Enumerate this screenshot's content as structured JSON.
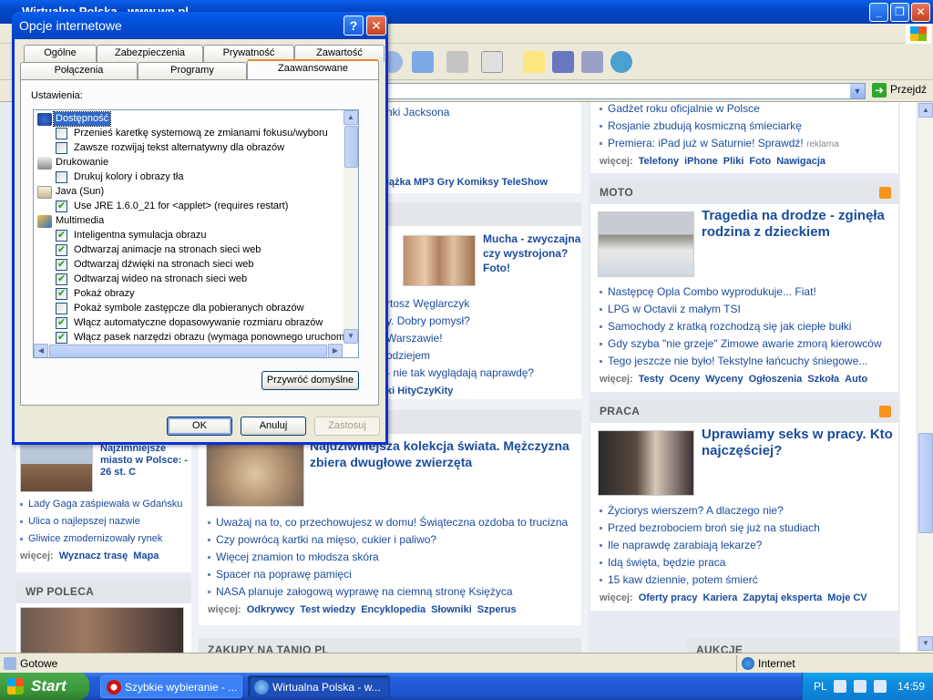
{
  "browser": {
    "title": "Wirtualna Polska - www.wp.pl",
    "go_label": "Przejdź",
    "status": "Gotowe",
    "zone": "Internet"
  },
  "page": {
    "left": {
      "weather_headline": "Najzimniejsze miasto w Polsce: - 26 st. C",
      "links": [
        "Lady Gaga zaśpiewała w Gdańsku",
        "Ulica o najlepszej nazwie",
        "Gliwice zmodernizowały rynek"
      ],
      "more_label": "więcej:",
      "more": [
        "Wyznacz trasę",
        "Mapa"
      ],
      "poleca_head": "WP POLECA"
    },
    "mid": {
      "top_link": "nki Jacksona",
      "top_more": "iążka MP3 Gry Komiksy TeleShow",
      "feature_headline": "Mucha - zwyczajna czy wystrojona? Foto!",
      "links_a": [
        "rtosz Węglarczyk",
        "y. Dobry pomysł?",
        "Warszawie!",
        "odziejem",
        "- nie tak wyglądają naprawdę?"
      ],
      "more_a": "ki HityCzyKity",
      "main_headline": "Najdziwniejsza kolekcja świata. Mężczyzna zbiera dwugłowe zwierzęta",
      "links_b": [
        "Uważaj na to, co przechowujesz w domu! Świąteczna ozdoba to trucizna",
        "Czy powrócą kartki na mięso, cukier i paliwo?",
        "Więcej znamion to młodsza skóra",
        "Spacer na poprawę pamięci",
        "NASA planuje załogową wyprawę na ciemną stronę Księżyca"
      ],
      "more_label": "więcej:",
      "more_b": [
        "Odkrywcy",
        "Test wiedzy",
        "Encyklopedia",
        "Słowniki",
        "Szperus"
      ],
      "zakupy_head": "ZAKUPY NA TANIO PL"
    },
    "right": {
      "tech_links": [
        "Gadżet roku oficjalnie w Polsce",
        "Rosjanie zbudują kosmiczną śmieciarkę",
        "Premiera: iPad już w Saturnie! Sprawdź!"
      ],
      "ad_label": "reklama",
      "more_label": "więcej:",
      "tech_more": [
        "Telefony",
        "iPhone",
        "Pliki",
        "Foto",
        "Nawigacja"
      ],
      "moto_head": "MOTO",
      "moto_headline": "Tragedia na drodze - zginęła rodzina z dzieckiem",
      "moto_links": [
        "Następcę Opla Combo wyprodukuje... Fiat!",
        "LPG w Octavii z małym TSI",
        "Samochody z kratką rozchodzą się jak ciepłe bułki",
        "Gdy szyba \"nie grzeje\" Zimowe awarie zmorą kierowców",
        "Tego jeszcze nie było! Tekstylne łańcuchy śniegowe..."
      ],
      "moto_more": [
        "Testy",
        "Oceny",
        "Wyceny",
        "Ogłoszenia",
        "Szkoła",
        "Auto"
      ],
      "praca_head": "PRACA",
      "praca_headline": "Uprawiamy seks w pracy. Kto najczęściej?",
      "praca_links": [
        "Życiorys wierszem? A dlaczego nie?",
        "Przed bezrobociem broń się już na studiach",
        "Ile naprawdę zarabiają lekarze?",
        "Idą święta, będzie praca",
        "15 kaw dziennie, potem śmierć"
      ],
      "praca_more": [
        "Oferty pracy",
        "Kariera",
        "Zapytaj eksperta",
        "Moje CV"
      ],
      "aukcje_head": "AUKCJE"
    }
  },
  "dialog": {
    "title": "Opcje internetowe",
    "tabs_row1": [
      "Ogólne",
      "Zabezpieczenia",
      "Prywatność",
      "Zawartość"
    ],
    "tabs_row2": [
      "Połączenia",
      "Programy",
      "Zaawansowane"
    ],
    "settings_label": "Ustawienia:",
    "tree": [
      {
        "type": "cat",
        "label": "Dostępność",
        "selected": true,
        "icon": "accessibility-icon"
      },
      {
        "type": "opt",
        "label": "Przenieś karetkę systemową ze zmianami fokusu/wyboru",
        "checked": false
      },
      {
        "type": "opt",
        "label": "Zawsze rozwijaj tekst alternatywny dla obrazów",
        "checked": false
      },
      {
        "type": "cat",
        "label": "Drukowanie",
        "icon": "printer-icon"
      },
      {
        "type": "opt",
        "label": "Drukuj kolory i obrazy tła",
        "checked": false
      },
      {
        "type": "cat",
        "label": "Java (Sun)",
        "icon": "java-icon"
      },
      {
        "type": "opt",
        "label": "Use JRE 1.6.0_21 for <applet> (requires restart)",
        "checked": true
      },
      {
        "type": "cat",
        "label": "Multimedia",
        "icon": "multimedia-icon"
      },
      {
        "type": "opt",
        "label": "Inteligentna symulacja obrazu",
        "checked": true
      },
      {
        "type": "opt",
        "label": "Odtwarzaj animacje na stronach sieci web",
        "checked": true
      },
      {
        "type": "opt",
        "label": "Odtwarzaj dźwięki na stronach sieci web",
        "checked": true
      },
      {
        "type": "opt",
        "label": "Odtwarzaj wideo na stronach sieci web",
        "checked": true
      },
      {
        "type": "opt",
        "label": "Pokaż obrazy",
        "checked": true
      },
      {
        "type": "opt",
        "label": "Pokaż symbole zastępcze dla pobieranych obrazów",
        "checked": false
      },
      {
        "type": "opt",
        "label": "Włącz automatyczne dopasowywanie rozmiaru obrazów",
        "checked": true
      },
      {
        "type": "opt",
        "label": "Włącz pasek narzędzi obrazu (wymaga ponownego uruchomie",
        "checked": true
      }
    ],
    "restore_defaults": "Przywróć domyślne",
    "ok": "OK",
    "cancel": "Anuluj",
    "apply": "Zastosuj"
  },
  "taskbar": {
    "start": "Start",
    "tasks": [
      "Szybkie wybieranie - ...",
      "Wirtualna Polska - w..."
    ],
    "lang": "PL",
    "clock": "14:59"
  },
  "colors": {
    "xp_blue": "#0a5fe8",
    "link": "#1a4c9c",
    "selection": "#316ac5",
    "start_green": "#3c9a3c"
  }
}
